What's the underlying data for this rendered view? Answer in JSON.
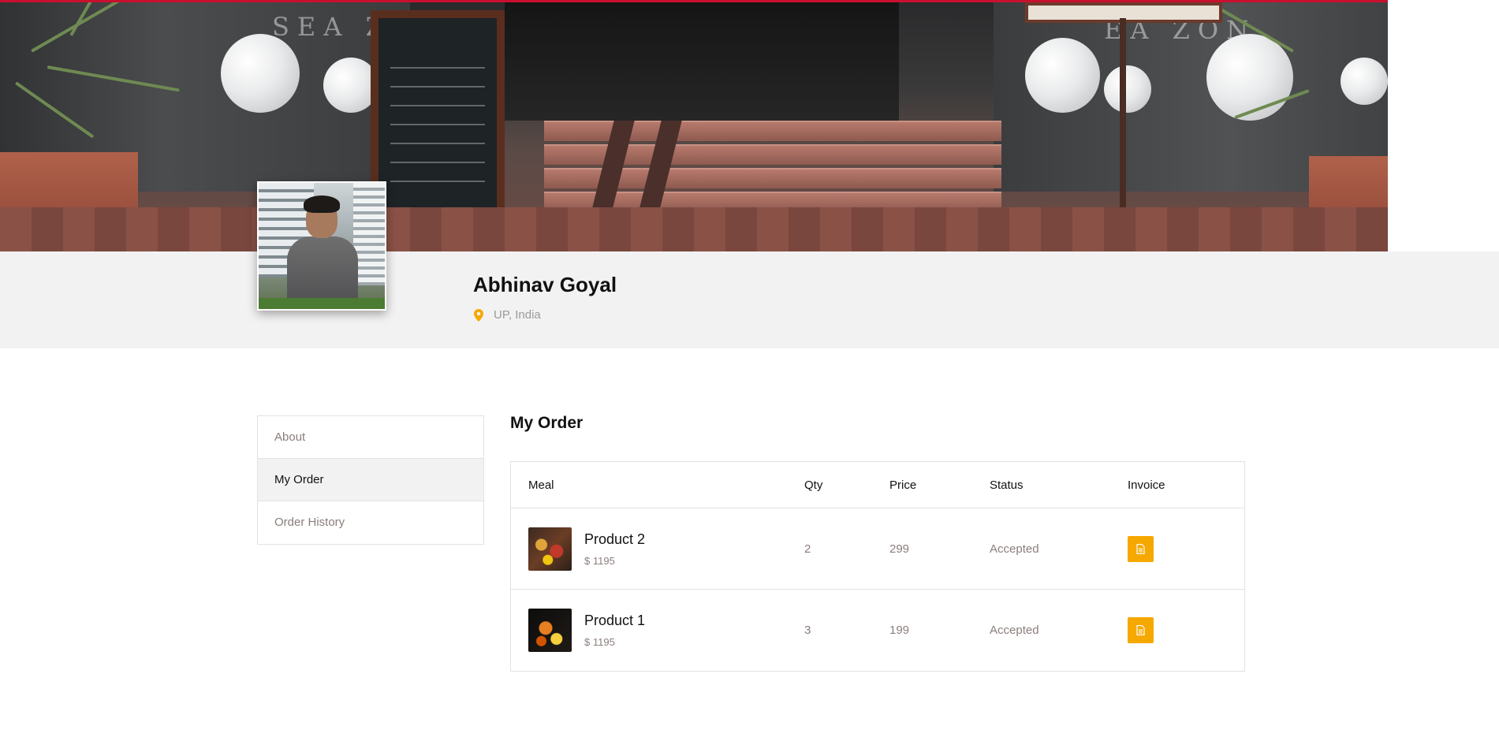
{
  "profile": {
    "name": "Abhinav Goyal",
    "location": "UP, India"
  },
  "sidebar": {
    "items": [
      {
        "label": "About"
      },
      {
        "label": "My Order",
        "active": true
      },
      {
        "label": "Order History"
      }
    ]
  },
  "orders": {
    "title": "My Order",
    "headers": {
      "meal": "Meal",
      "qty": "Qty",
      "price": "Price",
      "status": "Status",
      "invoice": "Invoice"
    },
    "rows": [
      {
        "name": "Product 2",
        "subtotal": "$ 1195",
        "qty": "2",
        "price": "299",
        "status": "Accepted",
        "invoice_icon": "file-icon"
      },
      {
        "name": "Product 1",
        "subtotal": "$ 1195",
        "qty": "3",
        "price": "199",
        "status": "Accepted",
        "invoice_icon": "file-icon"
      }
    ]
  },
  "colors": {
    "accent": "#f5a800",
    "top_bar": "#c8102e",
    "band": "#f2f2f2",
    "muted_text": "#8a7e7a"
  },
  "icons": {
    "location": "map-pin-icon",
    "invoice": "file-icon"
  }
}
